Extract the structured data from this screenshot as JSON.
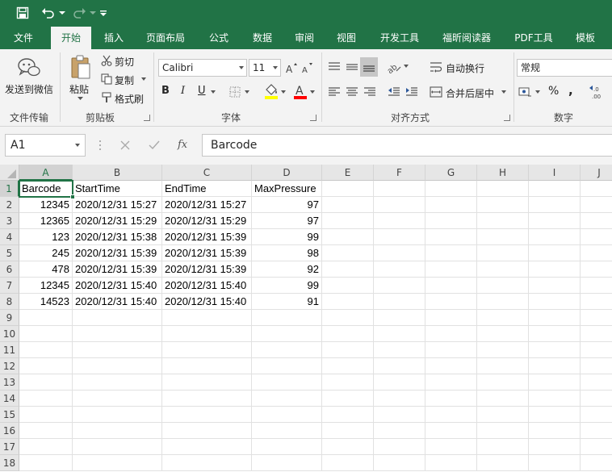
{
  "quick_access": {
    "save_icon": "save-icon",
    "undo_icon": "undo-icon",
    "redo_icon": "redo-icon",
    "customize_icon": "customize-qat-icon"
  },
  "tabs": [
    "文件",
    "开始",
    "插入",
    "页面布局",
    "公式",
    "数据",
    "审阅",
    "视图",
    "开发工具",
    "福昕阅读器",
    "PDF工具",
    "模板"
  ],
  "active_tab": "开始",
  "ribbon": {
    "wechat": {
      "label": "发送到微信",
      "group": "文件传输"
    },
    "clipboard": {
      "paste": "粘贴",
      "cut": "剪切",
      "copy": "复制",
      "format_painter": "格式刷",
      "group": "剪贴板"
    },
    "font": {
      "name": "Calibri",
      "size": "11",
      "bold": "B",
      "italic": "I",
      "underline": "U",
      "font_color_letter": "A",
      "group": "字体"
    },
    "alignment": {
      "wrap_text": "自动换行",
      "merge_center": "合并后居中",
      "group": "对齐方式"
    },
    "number": {
      "format": "常规",
      "percent": "%",
      "comma": ",",
      "group": "数字"
    },
    "colors": {
      "accent": "#217346",
      "highlight": "#ffff00",
      "font_color": "#ff0000"
    }
  },
  "formula_bar": {
    "name_box": "A1",
    "fx": "fx",
    "content": "Barcode"
  },
  "sheet": {
    "columns": [
      "A",
      "B",
      "C",
      "D",
      "E",
      "F",
      "G",
      "H",
      "I",
      "J"
    ],
    "row_numbers": [
      "1",
      "2",
      "3",
      "4",
      "5",
      "6",
      "7",
      "8",
      "9",
      "10",
      "11",
      "12",
      "13",
      "14",
      "15",
      "16",
      "17",
      "18"
    ],
    "header": [
      "Barcode",
      "StartTime",
      "EndTime",
      "MaxPressure"
    ],
    "rows": [
      [
        "12345",
        "2020/12/31 15:27",
        "2020/12/31 15:27",
        "97"
      ],
      [
        "12365",
        "2020/12/31 15:29",
        "2020/12/31 15:29",
        "97"
      ],
      [
        "123",
        "2020/12/31 15:38",
        "2020/12/31 15:39",
        "99"
      ],
      [
        "245",
        "2020/12/31 15:39",
        "2020/12/31 15:39",
        "98"
      ],
      [
        "478",
        "2020/12/31 15:39",
        "2020/12/31 15:39",
        "92"
      ],
      [
        "12345",
        "2020/12/31 15:40",
        "2020/12/31 15:40",
        "99"
      ],
      [
        "14523",
        "2020/12/31 15:40",
        "2020/12/31 15:40",
        "91"
      ]
    ],
    "active_cell": "A1"
  }
}
